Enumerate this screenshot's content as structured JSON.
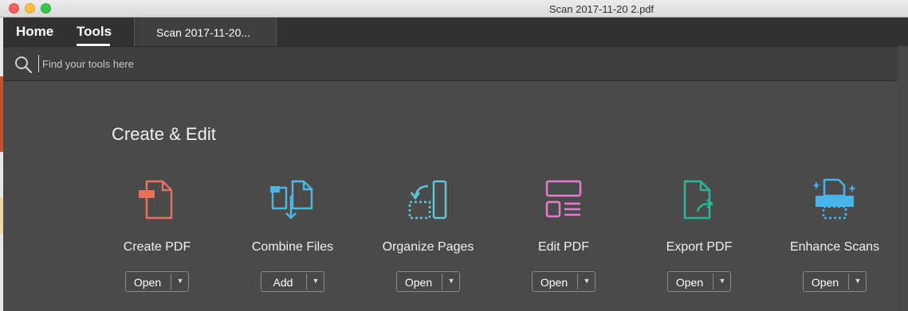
{
  "window": {
    "title": "Scan 2017-11-20 2.pdf"
  },
  "nav": {
    "home_label": "Home",
    "tools_label": "Tools",
    "doc_tab_label": "Scan 2017-11-20..."
  },
  "search": {
    "placeholder": "Find your tools here"
  },
  "section": {
    "title": "Create & Edit"
  },
  "tools": [
    {
      "name": "Create PDF",
      "button": "Open",
      "icon": "create-pdf-icon",
      "color": "#e8705c"
    },
    {
      "name": "Combine Files",
      "button": "Add",
      "icon": "combine-files-icon",
      "color": "#4cb7e6"
    },
    {
      "name": "Organize Pages",
      "button": "Open",
      "icon": "organize-pages-icon",
      "color": "#5ac8d8"
    },
    {
      "name": "Edit PDF",
      "button": "Open",
      "icon": "edit-pdf-icon",
      "color": "#e57ad3"
    },
    {
      "name": "Export PDF",
      "button": "Open",
      "icon": "export-pdf-icon",
      "color": "#26b896"
    },
    {
      "name": "Enhance Scans",
      "button": "Open",
      "icon": "enhance-scans-icon",
      "color": "#47b4ec"
    }
  ],
  "colors": {
    "background": "#4a4a4a",
    "tabbar": "#323232",
    "searchbar": "#3e3e3e"
  }
}
